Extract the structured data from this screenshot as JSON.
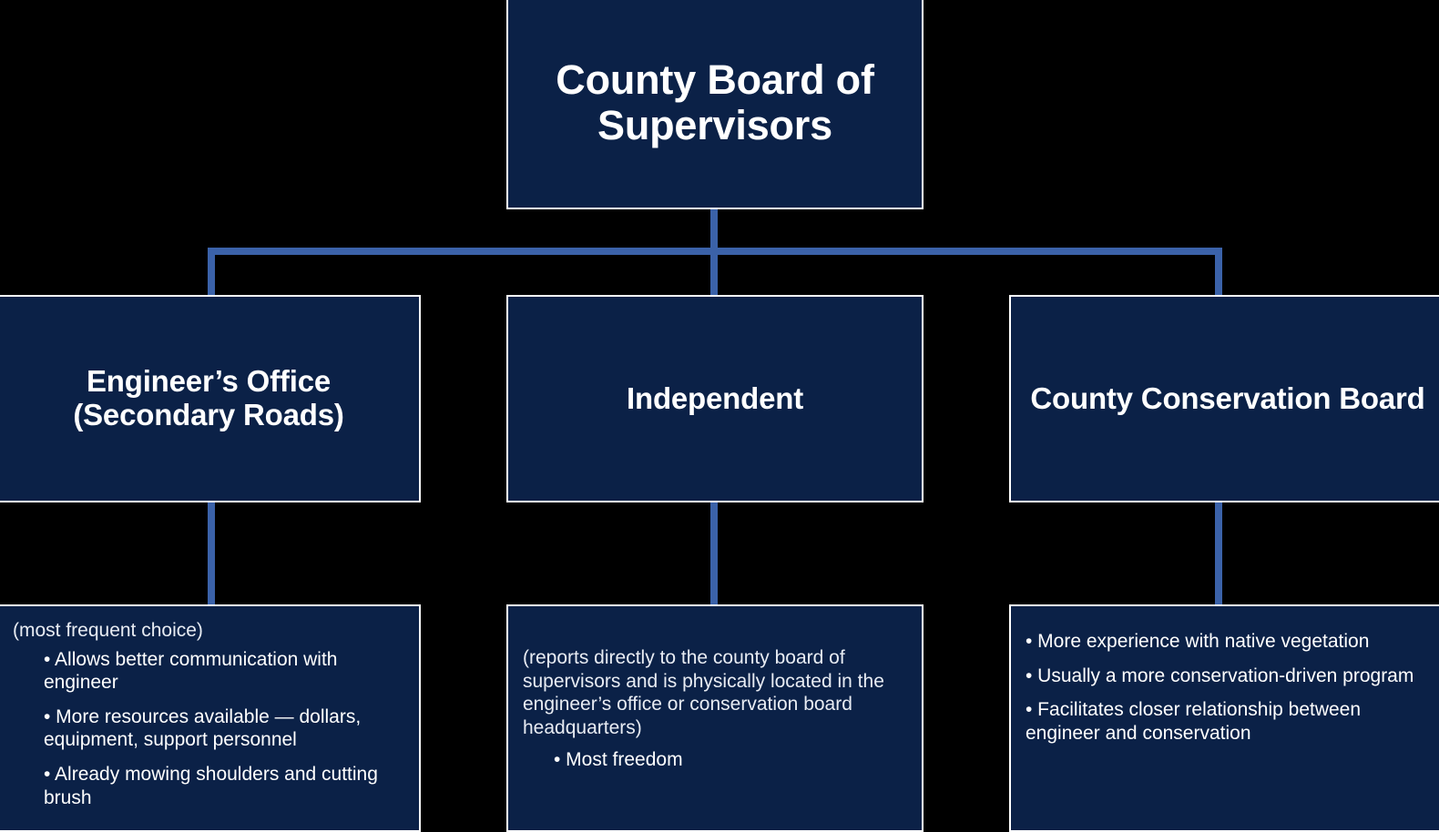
{
  "diagram": {
    "type": "organizational-hierarchy",
    "background_color": "#000000",
    "box_fill_color": "#0b2147",
    "box_border_color": "#ffffff",
    "connector_color": "#3b62a9",
    "text_color": "#ffffff"
  },
  "root": {
    "label": "County Board of Supervisors"
  },
  "branches": [
    {
      "id": "engineer",
      "label": "Engineer’s Office (Secondary Roads)",
      "detail": {
        "lead": "(most frequent choice)",
        "bullets": [
          "• Allows better communication with engineer",
          "• More resources available — dollars, equipment, support personnel",
          "• Already mowing shoulders and cutting brush"
        ]
      }
    },
    {
      "id": "independent",
      "label": "Independent",
      "detail": {
        "lead": "(reports directly to the county board of supervisors and is physically located in the engineer’s office or conservation board headquarters)",
        "bullets": [
          "• Most freedom"
        ]
      }
    },
    {
      "id": "conservation",
      "label": "County Conservation Board",
      "detail": {
        "lead": "",
        "bullets": [
          "• More experience with native vegetation",
          "• Usually a more conservation-driven program",
          "• Facilitates closer relationship between engineer and conservation"
        ]
      }
    }
  ]
}
